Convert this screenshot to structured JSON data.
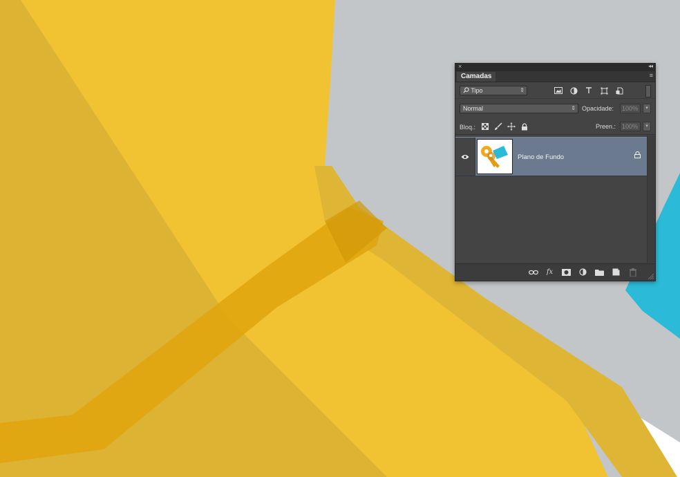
{
  "panel": {
    "close_glyph": "×",
    "collapse_glyph": "◂◂",
    "tab_label": "Camadas",
    "menu_glyph": "≡",
    "filter": {
      "value": "Tipo",
      "icon": "search-icon"
    },
    "filter_icons": [
      "image-filter-icon",
      "adjustment-filter-icon",
      "type-filter-icon",
      "shape-filter-icon",
      "smart-object-filter-icon"
    ],
    "blend_mode": "Normal",
    "opacity_label": "Opacidade:",
    "opacity_value": "100%",
    "lock_label": "Bloq.:",
    "lock_icons": [
      "lock-transparent-icon",
      "lock-pixels-icon",
      "lock-position-icon",
      "lock-all-icon"
    ],
    "fill_label": "Preen.:",
    "fill_value": "100%",
    "layers": [
      {
        "name": "Plano de Fundo",
        "visible": true,
        "locked": true,
        "selected": true
      }
    ],
    "bottom_icons": [
      "link-layers-icon",
      "fx-icon",
      "layer-mask-icon",
      "adjustment-layer-icon",
      "group-folder-icon",
      "new-layer-icon",
      "trash-icon"
    ],
    "colors": {
      "panel_bg": "#444444",
      "selected_row": "#6b7a8f",
      "titlebar": "#2b2b2b"
    }
  },
  "canvas": {
    "colors": {
      "yellow": "#f1c332",
      "dark_yellow": "#ddb333",
      "orange_band": "#e0a50e",
      "gray": "#c3c6c8",
      "cyan": "#2bbad7",
      "white": "#ffffff"
    }
  }
}
